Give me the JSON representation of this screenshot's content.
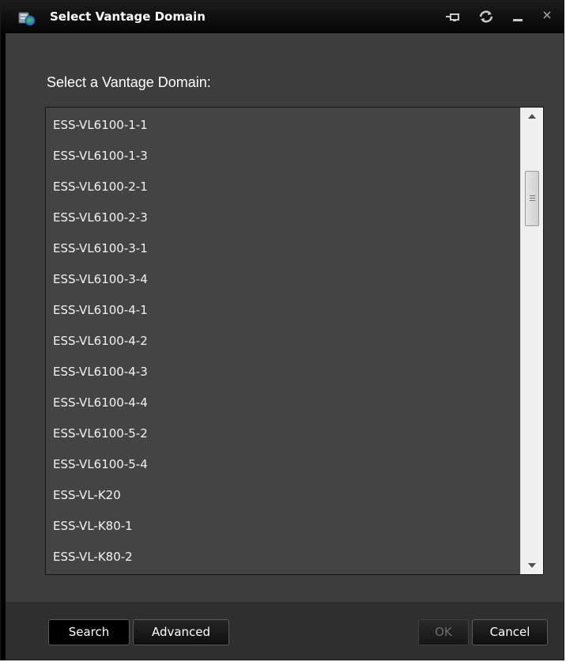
{
  "window": {
    "title": "Select Vantage Domain",
    "icons": [
      "vantage-domain-icon",
      "dock-icon",
      "refresh-icon",
      "minimize-icon",
      "close-icon"
    ]
  },
  "prompt": "Select a Vantage Domain:",
  "domains": [
    "ESS-VL6100-1-1",
    "ESS-VL6100-1-3",
    "ESS-VL6100-2-1",
    "ESS-VL6100-2-3",
    "ESS-VL6100-3-1",
    "ESS-VL6100-3-4",
    "ESS-VL6100-4-1",
    "ESS-VL6100-4-2",
    "ESS-VL6100-4-3",
    "ESS-VL6100-4-4",
    "ESS-VL6100-5-2",
    "ESS-VL6100-5-4",
    "ESS-VL-K20",
    "ESS-VL-K80-1",
    "ESS-VL-K80-2"
  ],
  "buttons": {
    "search": "Search",
    "advanced": "Advanced",
    "ok": "OK",
    "cancel": "Cancel"
  },
  "colors": {
    "window_background": "#3d3d3d",
    "list_background": "#444444",
    "title_bar": "#0a0a0a",
    "disabled_text": "#6e6e6e"
  }
}
